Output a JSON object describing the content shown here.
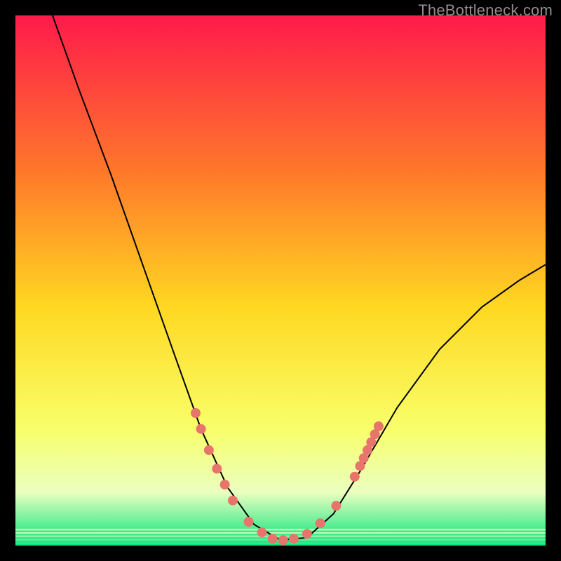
{
  "watermark": "TheBottleneck.com",
  "colors": {
    "gradient_top": "#ff1a4b",
    "gradient_mid_upper": "#ff7a2a",
    "gradient_mid": "#ffd821",
    "gradient_lower": "#f8ff6a",
    "gradient_band": "#eaffc0",
    "gradient_bottom": "#00e37a",
    "curve": "#000000",
    "marker": "#e8756b",
    "frame_bg": "#000000"
  },
  "chart_data": {
    "type": "line",
    "title": "",
    "xlabel": "",
    "ylabel": "",
    "xlim": [
      0,
      100
    ],
    "ylim": [
      0,
      100
    ],
    "curve": {
      "name": "bottleneck-curve",
      "points": [
        {
          "x": 7,
          "y": 100
        },
        {
          "x": 12,
          "y": 86
        },
        {
          "x": 18,
          "y": 70
        },
        {
          "x": 24,
          "y": 53
        },
        {
          "x": 30,
          "y": 36
        },
        {
          "x": 35,
          "y": 22
        },
        {
          "x": 40,
          "y": 11
        },
        {
          "x": 45,
          "y": 4
        },
        {
          "x": 50,
          "y": 1
        },
        {
          "x": 55,
          "y": 1.5
        },
        {
          "x": 60,
          "y": 6
        },
        {
          "x": 65,
          "y": 14
        },
        {
          "x": 72,
          "y": 26
        },
        {
          "x": 80,
          "y": 37
        },
        {
          "x": 88,
          "y": 45
        },
        {
          "x": 95,
          "y": 50
        },
        {
          "x": 100,
          "y": 53
        }
      ]
    },
    "markers": [
      {
        "x": 34,
        "y": 25
      },
      {
        "x": 35,
        "y": 22
      },
      {
        "x": 36.5,
        "y": 18
      },
      {
        "x": 38,
        "y": 14.5
      },
      {
        "x": 39.5,
        "y": 11.5
      },
      {
        "x": 41,
        "y": 8.5
      },
      {
        "x": 44,
        "y": 4.5
      },
      {
        "x": 46.5,
        "y": 2.5
      },
      {
        "x": 48.5,
        "y": 1.3
      },
      {
        "x": 50.5,
        "y": 1
      },
      {
        "x": 52.5,
        "y": 1.3
      },
      {
        "x": 55,
        "y": 2.2
      },
      {
        "x": 57.5,
        "y": 4.2
      },
      {
        "x": 60.5,
        "y": 7.5
      },
      {
        "x": 64,
        "y": 13
      },
      {
        "x": 65,
        "y": 15
      },
      {
        "x": 65.7,
        "y": 16.5
      },
      {
        "x": 66.4,
        "y": 18
      },
      {
        "x": 67.1,
        "y": 19.5
      },
      {
        "x": 67.8,
        "y": 21
      },
      {
        "x": 68.5,
        "y": 22.5
      }
    ],
    "green_band": {
      "y_start": 0,
      "y_end": 3
    }
  }
}
